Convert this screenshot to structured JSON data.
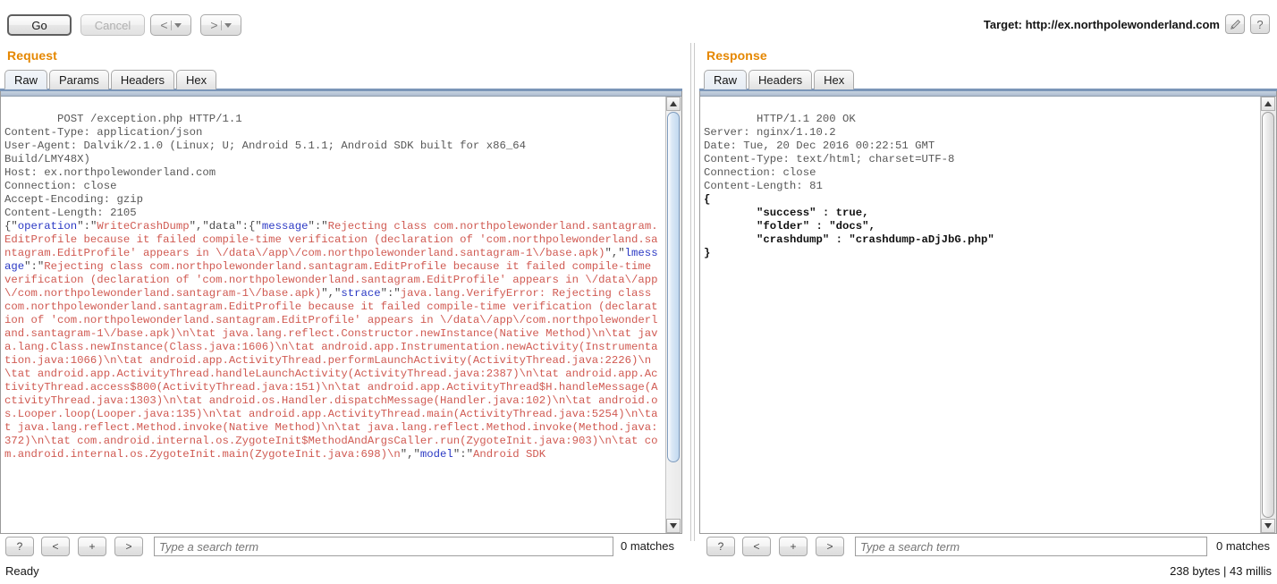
{
  "toolbar": {
    "go_label": "Go",
    "cancel_label": "Cancel",
    "back_label": "<",
    "forward_label": ">",
    "target_label": "Target: http://ex.northpolewonderland.com",
    "edit_icon": "pencil-icon",
    "help_icon": "?"
  },
  "request": {
    "title": "Request",
    "tabs": [
      {
        "label": "Raw",
        "active": true
      },
      {
        "label": "Params",
        "active": false
      },
      {
        "label": "Headers",
        "active": false
      },
      {
        "label": "Hex",
        "active": false
      }
    ],
    "headers_text": "POST /exception.php HTTP/1.1\nContent-Type: application/json\nUser-Agent: Dalvik/2.1.0 (Linux; U; Android 5.1.1; Android SDK built for x86_64\nBuild/LMY48X)\nHost: ex.northpolewonderland.com\nConnection: close\nAccept-Encoding: gzip\nContent-Length: 2105\n",
    "body_segments": [
      {
        "t": "punct",
        "v": "{\""
      },
      {
        "t": "key",
        "v": "operation"
      },
      {
        "t": "punct",
        "v": "\":\""
      },
      {
        "t": "str",
        "v": "WriteCrashDump"
      },
      {
        "t": "punct",
        "v": "\",\"data\":{\""
      },
      {
        "t": "key",
        "v": "message"
      },
      {
        "t": "punct",
        "v": "\":\""
      },
      {
        "t": "str",
        "v": "Rejecting class com.northpolewonderland.santagram.EditProfile because it failed compile-time verification (declaration of 'com.northpolewonderland.santagram.EditProfile' appears in \\/data\\/app\\/com.northpolewonderland.santagram-1\\/base.apk)"
      },
      {
        "t": "punct",
        "v": "\",\""
      },
      {
        "t": "key",
        "v": "lmessage"
      },
      {
        "t": "punct",
        "v": "\":\""
      },
      {
        "t": "str",
        "v": "Rejecting class com.northpolewonderland.santagram.EditProfile because it failed compile-time verification (declaration of 'com.northpolewonderland.santagram.EditProfile' appears in \\/data\\/app\\/com.northpolewonderland.santagram-1\\/base.apk)"
      },
      {
        "t": "punct",
        "v": "\",\""
      },
      {
        "t": "key",
        "v": "strace"
      },
      {
        "t": "punct",
        "v": "\":\""
      },
      {
        "t": "str",
        "v": "java.lang.VerifyError: Rejecting class com.northpolewonderland.santagram.EditProfile because it failed compile-time verification (declaration of 'com.northpolewonderland.santagram.EditProfile' appears in \\/data\\/app\\/com.northpolewonderland.santagram-1\\/base.apk)\\n\\tat java.lang.reflect.Constructor.newInstance(Native Method)\\n\\tat java.lang.Class.newInstance(Class.java:1606)\\n\\tat android.app.Instrumentation.newActivity(Instrumentation.java:1066)\\n\\tat android.app.ActivityThread.performLaunchActivity(ActivityThread.java:2226)\\n\\tat android.app.ActivityThread.handleLaunchActivity(ActivityThread.java:2387)\\n\\tat android.app.ActivityThread.access$800(ActivityThread.java:151)\\n\\tat android.app.ActivityThread$H.handleMessage(ActivityThread.java:1303)\\n\\tat android.os.Handler.dispatchMessage(Handler.java:102)\\n\\tat android.os.Looper.loop(Looper.java:135)\\n\\tat android.app.ActivityThread.main(ActivityThread.java:5254)\\n\\tat java.lang.reflect.Method.invoke(Native Method)\\n\\tat java.lang.reflect.Method.invoke(Method.java:372)\\n\\tat com.android.internal.os.ZygoteInit$MethodAndArgsCaller.run(ZygoteInit.java:903)\\n\\tat com.android.internal.os.ZygoteInit.main(ZygoteInit.java:698)\\n"
      },
      {
        "t": "punct",
        "v": "\",\""
      },
      {
        "t": "key",
        "v": "model"
      },
      {
        "t": "punct",
        "v": "\":\""
      },
      {
        "t": "str",
        "v": "Android SDK"
      }
    ],
    "search_placeholder": "Type a search term",
    "search_value": "",
    "matches_text": "0 matches",
    "search_buttons": [
      "?",
      "<",
      "+",
      ">"
    ]
  },
  "response": {
    "title": "Response",
    "tabs": [
      {
        "label": "Raw",
        "active": true
      },
      {
        "label": "Headers",
        "active": false
      },
      {
        "label": "Hex",
        "active": false
      }
    ],
    "headers_text": "HTTP/1.1 200 OK\nServer: nginx/1.10.2\nDate: Tue, 20 Dec 2016 00:22:51 GMT\nContent-Type: text/html; charset=UTF-8\nConnection: close\nContent-Length: 81\n",
    "body_text": "{\n        \"success\" : true,\n        \"folder\" : \"docs\",\n        \"crashdump\" : \"crashdump-aDjJbG.php\"\n}",
    "search_placeholder": "Type a search term",
    "search_value": "",
    "matches_text": "0 matches",
    "search_buttons": [
      "?",
      "<",
      "+",
      ">"
    ]
  },
  "statusbar": {
    "left_text": "Ready",
    "right_text": "238 bytes | 43 millis"
  },
  "colors": {
    "accent": "#e58700",
    "json_key": "#2b39c4",
    "json_string": "#d05a52",
    "tab_underline": "#7b96b8"
  }
}
